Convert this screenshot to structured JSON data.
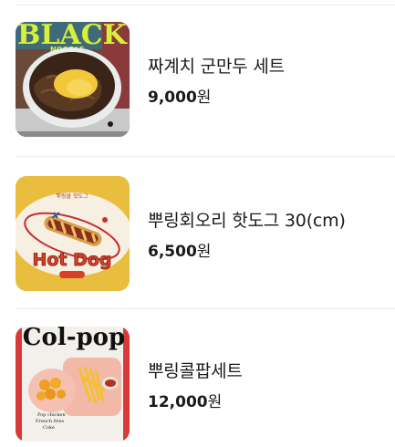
{
  "menu": {
    "items": [
      {
        "name": "짜계치 군만두 세트",
        "price": "9,000",
        "currency": "원",
        "image_text": [
          "BLACK",
          "NOODLE"
        ]
      },
      {
        "name": "뿌링회오리 핫도그 30(cm)",
        "price": "6,500",
        "currency": "원",
        "image_text": [
          "뿌링클 핫도그",
          "Hot Dog"
        ]
      },
      {
        "name": "뿌링콜팝세트",
        "price": "12,000",
        "currency": "원",
        "image_text": [
          "Col-pop",
          "Pop chicken",
          "French fries",
          "Coke"
        ]
      }
    ]
  }
}
